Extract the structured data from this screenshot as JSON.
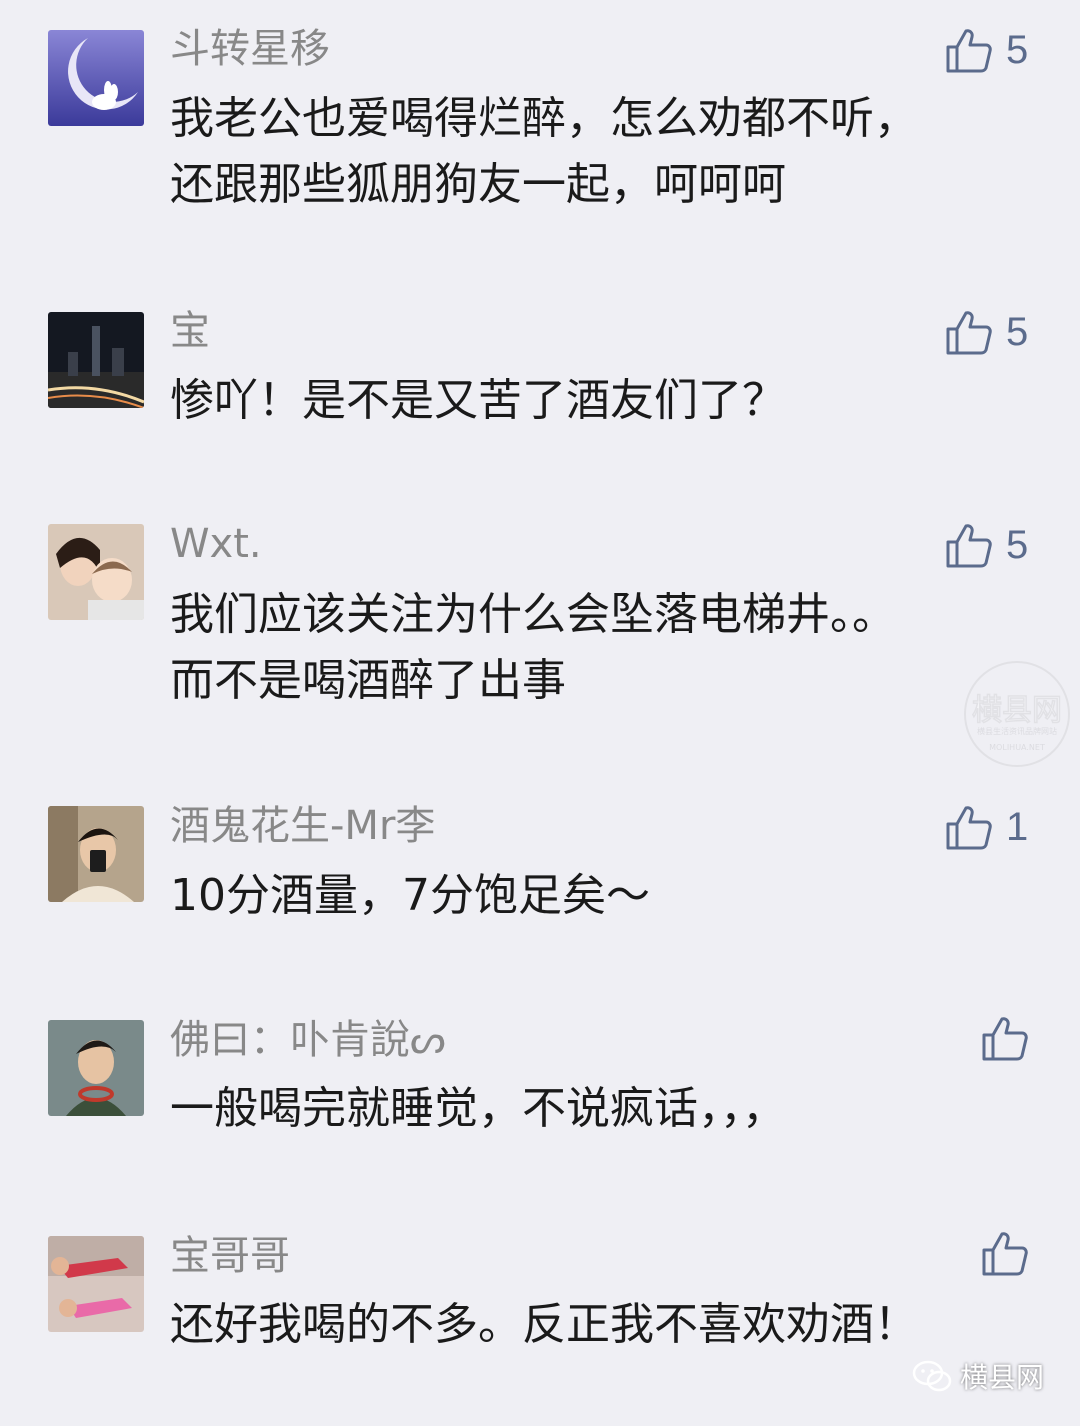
{
  "comments": [
    {
      "user": "斗转星移",
      "text": "我老公也爱喝得烂醉，怎么劝都不听，\n还跟那些狐朋狗友一起，呵呵呵",
      "likes": "5",
      "avatar_icon": "moon-rabbit-avatar"
    },
    {
      "user": "宝",
      "text": "惨吖！是不是又苦了酒友们了？",
      "likes": "5",
      "avatar_icon": "night-city-avatar"
    },
    {
      "user": "Wxt.",
      "text": "我们应该关注为什么会坠落电梯井。。\n而不是喝酒醉了出事",
      "likes": "5",
      "avatar_icon": "mother-baby-avatar"
    },
    {
      "user": "酒鬼花生-Mr李",
      "text": "10分酒量，7分饱足矣～",
      "likes": "1",
      "avatar_icon": "man-selfie-avatar"
    },
    {
      "user": "佛曰：卟肯說ᔕ",
      "text": "一般喝完就睡觉，不说疯话，，，",
      "likes": "",
      "avatar_icon": "young-man-avatar"
    },
    {
      "user": "宝哥哥",
      "text": "还好我喝的不多。反正我不喜欢劝酒！",
      "likes": "",
      "avatar_icon": "kids-avatar"
    }
  ],
  "watermark": {
    "title": "横县网",
    "subtitle": "横县生活资讯品牌网站",
    "url": "MOLIHUA.NET"
  },
  "brand": {
    "name": "横县网"
  },
  "colors": {
    "background": "#efeff4",
    "like": "#5b6b8c",
    "username": "#888888",
    "text": "#1a1a1a"
  }
}
